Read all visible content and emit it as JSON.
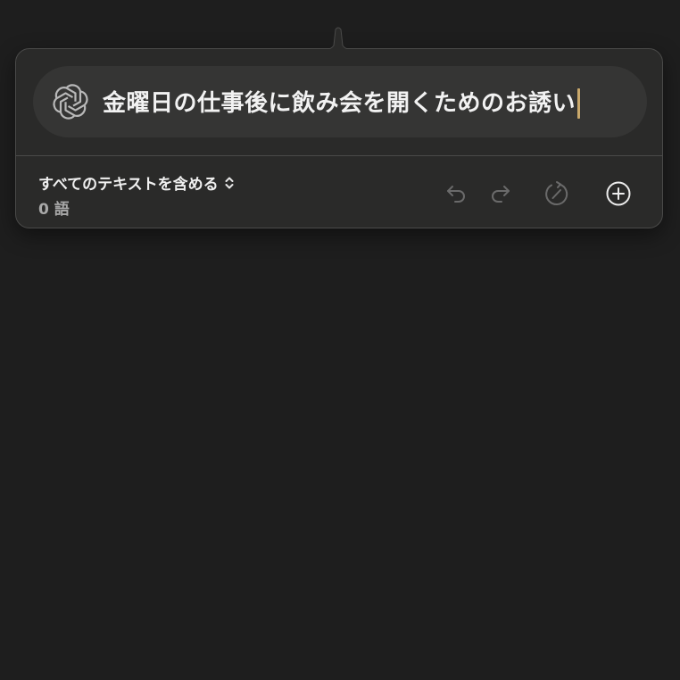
{
  "prompt": {
    "text": "金曜日の仕事後に飲み会を開くためのお誘い",
    "logo_icon": "openai-logo-icon",
    "cursor_color": "#c9a86b"
  },
  "footer": {
    "scope_label": "すべてのテキストを含める",
    "scope_icon": "chevron-up-down-icon",
    "word_count": "0 語"
  },
  "toolbar": {
    "undo_icon": "undo-icon",
    "redo_icon": "redo-icon",
    "timer_icon": "timer-icon",
    "add_icon": "plus-circle-icon"
  },
  "colors": {
    "background": "#1e1e1e",
    "panel": "#2a2a29",
    "pill": "#353534",
    "border": "#4a4a49"
  }
}
